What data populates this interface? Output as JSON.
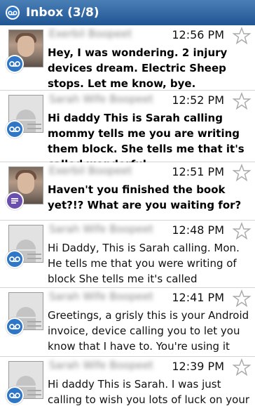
{
  "header": {
    "title": "Inbox (3/8)",
    "background": "#2d63a0",
    "icon": "voicemail-icon"
  },
  "messages": [
    {
      "sender": "Exerbil Boopeet",
      "time": "12:56 PM",
      "preview": "Hey, I was wondering. 2 injury devices dream. Electric Sheep stops. Let me know, bye.",
      "unread": true,
      "avatar": "photo",
      "badge": "voicemail-icon",
      "badge_color": "#2f76c7",
      "starred": false
    },
    {
      "sender": "Sarah Wife Boopeet",
      "time": "12:52 PM",
      "preview": "Hi daddy This is Sarah calling mommy tells me you are writing them block. She tells me that it's called wonderful.",
      "unread": true,
      "avatar": "generic",
      "badge": "voicemail-icon",
      "badge_color": "#2f76c7",
      "starred": false
    },
    {
      "sender": "Exerbil Boopeet",
      "time": "12:51 PM",
      "preview": "Haven't you finished the book yet?!? What are you waiting for?",
      "unread": true,
      "avatar": "photo",
      "badge": "text-message-icon",
      "badge_color": "#6a4fae",
      "starred": false
    },
    {
      "sender": "Sarah Wife Boopeet",
      "time": "12:48 PM",
      "preview": "Hi Daddy, This is Sarah calling. Mon. He tells me that you were writing of block She tells me it's called wonderful robot",
      "unread": false,
      "avatar": "generic",
      "badge": "voicemail-icon",
      "badge_color": "#2f76c7",
      "starred": false
    },
    {
      "sender": "Sarah Wife Boopeet",
      "time": "12:41 PM",
      "preview": "Greetings, a grisly this is your Android invoice, device calling you to let you know that I have to. You're using it with",
      "unread": false,
      "avatar": "generic",
      "badge": "voicemail-icon",
      "badge_color": "#2f76c7",
      "starred": false
    },
    {
      "sender": "Sarah Wife Boopeet",
      "time": "12:39 PM",
      "preview": "Hi daddy This is Sarah. I was just calling to wish you lots of luck on your new book",
      "unread": false,
      "avatar": "generic",
      "badge": "voicemail-icon",
      "badge_color": "#2f76c7",
      "starred": false
    }
  ]
}
